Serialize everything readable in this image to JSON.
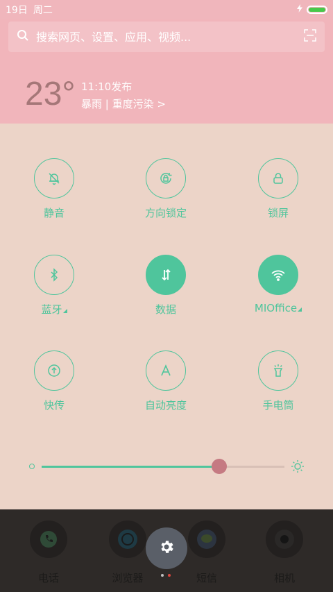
{
  "status": {
    "date": "19日",
    "weekday": "周二"
  },
  "search": {
    "placeholder": "搜索网页、设置、应用、视频..."
  },
  "weather": {
    "temp": "23°",
    "time": "11:10发布",
    "desc": "暴雨 | 重度污染 >"
  },
  "toggles": [
    {
      "label": "静音",
      "icon": "bell-off-icon",
      "on": false
    },
    {
      "label": "方向锁定",
      "icon": "rotation-lock-icon",
      "on": false
    },
    {
      "label": "锁屏",
      "icon": "lock-icon",
      "on": false
    },
    {
      "label": "蓝牙",
      "icon": "bluetooth-icon",
      "on": false
    },
    {
      "label": "数据",
      "icon": "data-icon",
      "on": true
    },
    {
      "label": "MIOffice",
      "icon": "wifi-icon",
      "on": true
    },
    {
      "label": "快传",
      "icon": "transfer-icon",
      "on": false
    },
    {
      "label": "自动亮度",
      "icon": "auto-brightness-icon",
      "on": false
    },
    {
      "label": "手电筒",
      "icon": "flashlight-icon",
      "on": false
    }
  ],
  "brightness": {
    "level": 0.73
  },
  "dock": [
    {
      "label": "电话",
      "icon": "phone-icon"
    },
    {
      "label": "浏览器",
      "icon": "browser-icon"
    },
    {
      "label": "短信",
      "icon": "message-icon"
    },
    {
      "label": "相机",
      "icon": "camera-icon"
    }
  ],
  "colors": {
    "accent": "#4fc59c",
    "panel": "#ecd4c8",
    "header": "#f1b5bb"
  }
}
